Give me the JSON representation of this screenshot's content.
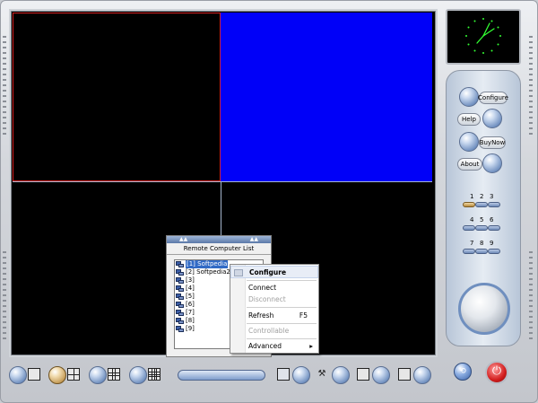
{
  "side_panel": {
    "configure_label": "Configure",
    "help_label": "Help",
    "buynow_label": "BuyNow",
    "about_label": "About",
    "layout_numbers": [
      "1",
      "2",
      "3",
      "4",
      "5",
      "6",
      "7",
      "8",
      "9"
    ]
  },
  "remote_list": {
    "title": "Remote Computer List",
    "up_arrows": "▲▲",
    "items": [
      "[1] Softpedia",
      "[2] Softpedia2",
      "[3]",
      "[4]",
      "[5]",
      "[6]",
      "[7]",
      "[8]",
      "[9]"
    ]
  },
  "context_menu": {
    "configure": "Configure",
    "connect": "Connect",
    "disconnect": "Disconnect",
    "refresh": "Refresh",
    "refresh_shortcut": "F5",
    "controllable": "Controllable",
    "advanced": "Advanced",
    "submenu_arrow": "▸"
  },
  "bottom_bar": {
    "tools_glyph": "⚒",
    "power_glyph": "⏻",
    "refresh_glyph": "⟲"
  },
  "colors": {
    "video_background": "#000000",
    "active_pane_border": "#d32020",
    "blue_pane": "#0000f8",
    "clock_hands": "#33ff33"
  }
}
